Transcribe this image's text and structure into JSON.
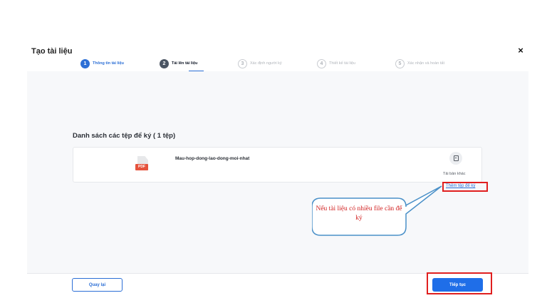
{
  "dialog": {
    "title": "Tạo tài liệu",
    "close_icon": "×"
  },
  "steps": [
    {
      "num": "1",
      "label": "Thông tin tài liệu",
      "state": "done"
    },
    {
      "num": "2",
      "label": "Tải lên tài liệu",
      "state": "active"
    },
    {
      "num": "3",
      "label": "Xác định người ký",
      "state": "todo"
    },
    {
      "num": "4",
      "label": "Thiết kế tài liệu",
      "state": "todo"
    },
    {
      "num": "5",
      "label": "Xác nhận và hoàn tất",
      "state": "todo"
    }
  ],
  "files": {
    "section_title": "Danh sách các tệp để ký ( 1 tệp)",
    "items": [
      {
        "type_badge": "PDF",
        "name": "Mau-hop-dong-lao-dong-moi-nhat",
        "reupload_label": "Tải bản khác"
      }
    ],
    "add_link": "Thêm tệp để ký"
  },
  "callout": {
    "text": "Nếu tài liệu có nhiều file cần để ký"
  },
  "footer": {
    "back_label": "Quay lại",
    "next_label": "Tiếp tục"
  },
  "colors": {
    "accent": "#2c6fd6",
    "highlight": "#e01f1f",
    "callout_border": "#4a90c8",
    "pdf": "#e5533d"
  }
}
